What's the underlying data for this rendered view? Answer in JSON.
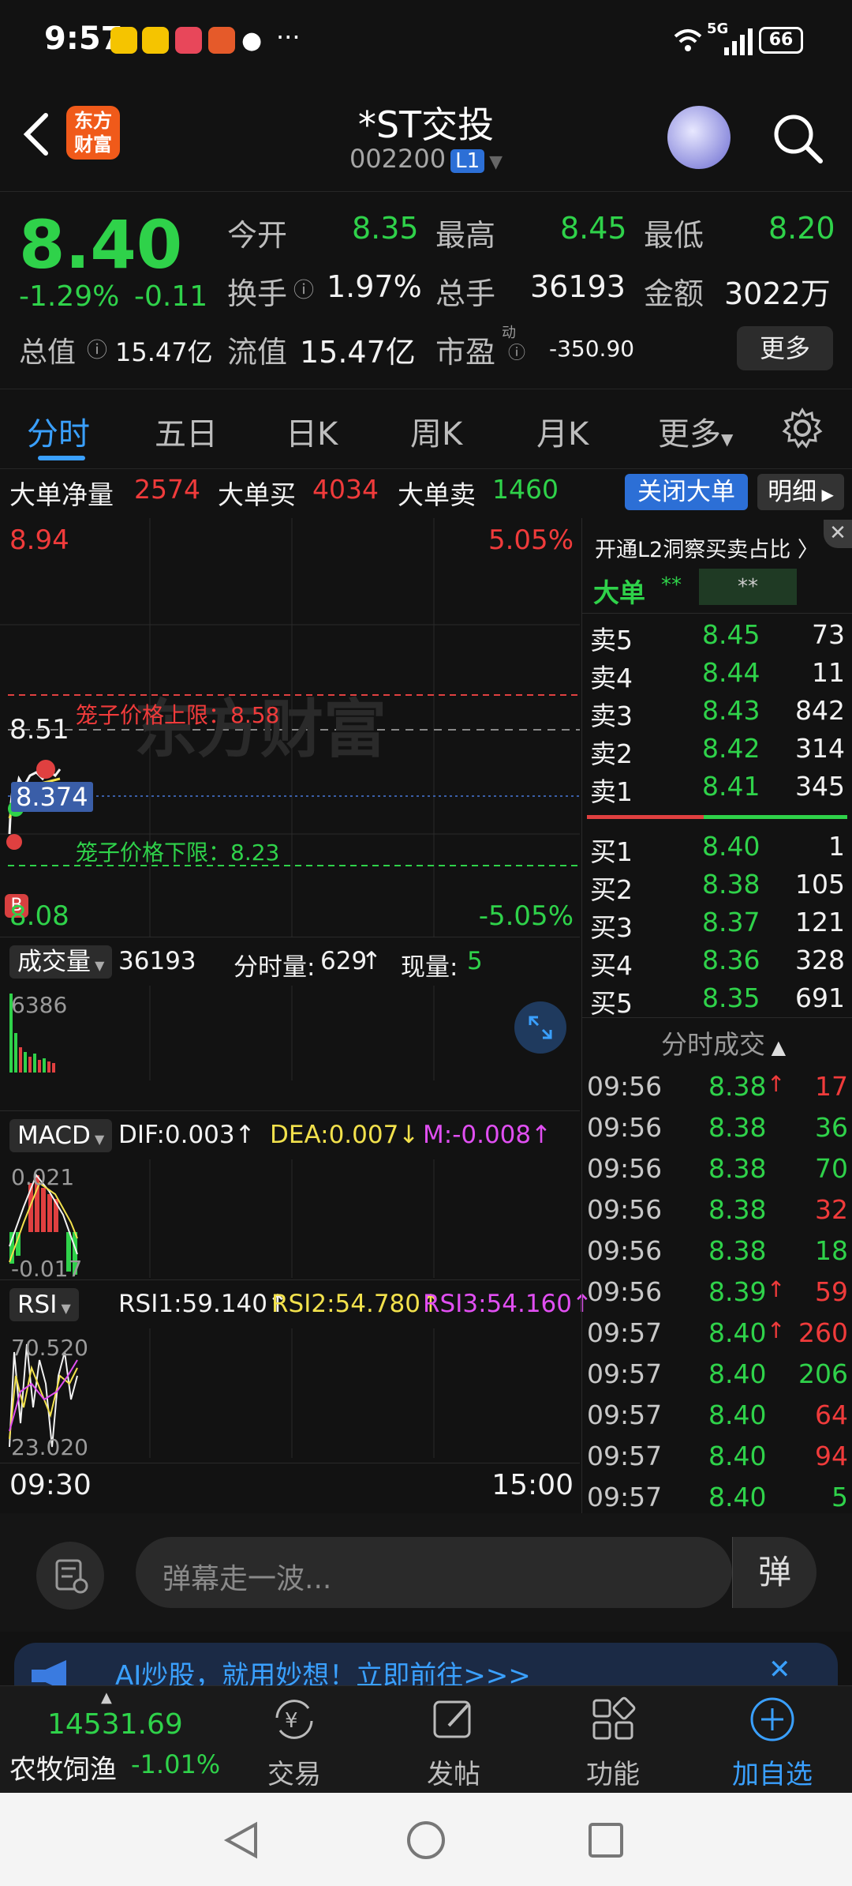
{
  "status_bar": {
    "time": "9:57",
    "more": "···",
    "network": "5G",
    "battery": "66"
  },
  "header": {
    "title": "*ST交投",
    "code": "002200",
    "level_badge": "L1",
    "logo_text": "东方\n财富"
  },
  "quote": {
    "price": "8.40",
    "change_pct": "-1.29%",
    "change": "-0.11",
    "open_label": "今开",
    "open": "8.35",
    "high_label": "最高",
    "high": "8.45",
    "low_label": "最低",
    "low": "8.20",
    "turnover_label": "换手",
    "turnover": "1.97%",
    "volume_label": "总手",
    "volume": "36193",
    "amount_label": "金额",
    "amount": "3022万",
    "mktcap_label": "总值",
    "mktcap": "15.47亿",
    "float_label": "流值",
    "float_cap": "15.47亿",
    "pe_label": "市盈",
    "pe_sup": "动",
    "pe": "-350.90",
    "more_button": "更多"
  },
  "tabs": [
    "分时",
    "五日",
    "日K",
    "周K",
    "月K",
    "更多"
  ],
  "big_orders": {
    "net_label": "大单净量",
    "net": "2574",
    "buy_label": "大单买",
    "buy": "4034",
    "sell_label": "大单卖",
    "sell": "1460",
    "close_button": "关闭大单",
    "detail_button": "明细"
  },
  "chart": {
    "price_top": "8.94",
    "pct_top": "5.05%",
    "price_mid": "8.51",
    "price_bottom": "8.08",
    "pct_bottom": "-5.05%",
    "current_tag": "8.374",
    "cage_upper": "笼子价格上限：8.58",
    "cage_lower": "笼子价格下限：8.23",
    "watermark": "东方财富",
    "b_marker": "B",
    "volume_selector": "成交量",
    "volume_total": "36193",
    "volume_min_label": "分时量:",
    "volume_min": "629",
    "volume_now_label": "现量:",
    "volume_now": "5",
    "volume_max": "6386",
    "macd_selector": "MACD",
    "dif": "DIF:0.003↑",
    "dea": "DEA:0.007↓",
    "m": "M:-0.008↑",
    "macd_top": "0.021",
    "macd_bottom": "-0.017",
    "rsi_selector": "RSI",
    "rsi1": "RSI1:59.140↑",
    "rsi2": "RSI2:54.780↑",
    "rsi3": "RSI3:54.160↑",
    "rsi_top": "70.520",
    "rsi_bottom": "23.020",
    "time_start": "09:30",
    "time_end": "15:00"
  },
  "right_panel": {
    "l2_banner": "开通L2洞察买卖占比",
    "big_label": "大单",
    "big_val1": "**",
    "big_val2": "**",
    "asks": [
      {
        "label": "卖5",
        "price": "8.45",
        "qty": "73"
      },
      {
        "label": "卖4",
        "price": "8.44",
        "qty": "11"
      },
      {
        "label": "卖3",
        "price": "8.43",
        "qty": "842"
      },
      {
        "label": "卖2",
        "price": "8.42",
        "qty": "314"
      },
      {
        "label": "卖1",
        "price": "8.41",
        "qty": "345"
      }
    ],
    "bids": [
      {
        "label": "买1",
        "price": "8.40",
        "qty": "1"
      },
      {
        "label": "买2",
        "price": "8.38",
        "qty": "105"
      },
      {
        "label": "买3",
        "price": "8.37",
        "qty": "121"
      },
      {
        "label": "买4",
        "price": "8.36",
        "qty": "328"
      },
      {
        "label": "买5",
        "price": "8.35",
        "qty": "691"
      }
    ],
    "ticks_title": "分时成交",
    "ticks": [
      {
        "time": "09:56",
        "price": "8.38",
        "arrow": "↑",
        "qty": "17",
        "dir": "red"
      },
      {
        "time": "09:56",
        "price": "8.38",
        "arrow": "",
        "qty": "36",
        "dir": "green"
      },
      {
        "time": "09:56",
        "price": "8.38",
        "arrow": "",
        "qty": "70",
        "dir": "green"
      },
      {
        "time": "09:56",
        "price": "8.38",
        "arrow": "",
        "qty": "32",
        "dir": "red"
      },
      {
        "time": "09:56",
        "price": "8.38",
        "arrow": "",
        "qty": "18",
        "dir": "green"
      },
      {
        "time": "09:56",
        "price": "8.39",
        "arrow": "↑",
        "qty": "59",
        "dir": "red"
      },
      {
        "time": "09:57",
        "price": "8.40",
        "arrow": "↑",
        "qty": "260",
        "dir": "red"
      },
      {
        "time": "09:57",
        "price": "8.40",
        "arrow": "",
        "qty": "206",
        "dir": "green"
      },
      {
        "time": "09:57",
        "price": "8.40",
        "arrow": "",
        "qty": "64",
        "dir": "red"
      },
      {
        "time": "09:57",
        "price": "8.40",
        "arrow": "",
        "qty": "94",
        "dir": "red"
      },
      {
        "time": "09:57",
        "price": "8.40",
        "arrow": "",
        "qty": "5",
        "dir": "green"
      }
    ]
  },
  "danmaku": {
    "placeholder": "弹幕走一波...",
    "toggle": "弹"
  },
  "ad": {
    "text": "AI炒股，就用妙想！立即前往>>>"
  },
  "bottom_nav": {
    "index_value": "14531.69",
    "index_name": "农牧饲渔",
    "index_change": "-1.01%",
    "items": [
      "交易",
      "发帖",
      "功能",
      "加自选"
    ]
  },
  "colors": {
    "up": "#f03b3b",
    "down": "#2fd24a",
    "accent": "#3aa0ff",
    "bg": "#121212"
  }
}
